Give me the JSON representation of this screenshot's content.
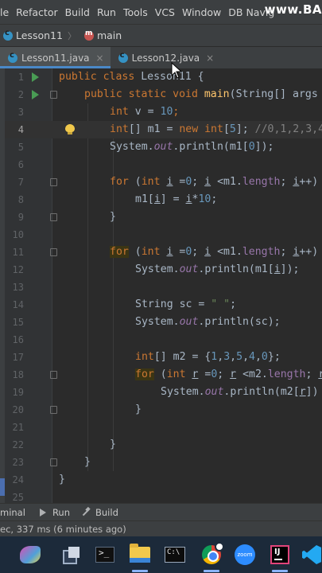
{
  "menu": {
    "items": [
      "le",
      "Refactor",
      "Build",
      "Run",
      "Tools",
      "VCS",
      "Window",
      "DB Navig"
    ],
    "watermark": "www.BA"
  },
  "breadcrumb": {
    "class_name": "Lesson11",
    "method_name": "main"
  },
  "tabs": [
    {
      "label": "Lesson11.java",
      "active": true,
      "close": "×"
    },
    {
      "label": "Lesson12.java",
      "active": false,
      "close": "×"
    }
  ],
  "editor": {
    "current_line": 4,
    "line_numbers": [
      "1",
      "2",
      "3",
      "4",
      "5",
      "6",
      "7",
      "8",
      "9",
      "10",
      "11",
      "12",
      "13",
      "14",
      "15",
      "16",
      "17",
      "18",
      "19",
      "20",
      "21",
      "22",
      "23",
      "24",
      "25"
    ],
    "lines": {
      "l1": {
        "kw1": "public class ",
        "name": "Lesson11 {"
      },
      "l2": {
        "kw1": "public static void ",
        "fn": "main",
        "rest": "(String[] args"
      },
      "l3": {
        "kw": "int ",
        "name": "v = ",
        "num": "10",
        "end": ";"
      },
      "l4": {
        "kw": "int",
        "a": "[] m1 = ",
        "kw2": "new int",
        "b": "[",
        "num": "5",
        "c": "]; ",
        "cmt": "//0,1,2,3,4"
      },
      "l5": {
        "a": "System.",
        "fld": "out",
        "b": ".println(m1[",
        "num": "0",
        "c": "]);"
      },
      "l7": {
        "kw": "for",
        "a": " (",
        "kw2": "int ",
        "v1": "i",
        "b": " =",
        "num": "0",
        "c": "; ",
        "v2": "i",
        "d": " <m1.",
        "fld": "length",
        "e": "; ",
        "v3": "i",
        "f": "++)"
      },
      "l8": {
        "a": "m1[",
        "v1": "i",
        "b": "] = ",
        "v2": "i",
        "c": "*",
        "num": "10",
        "d": ";"
      },
      "l9": {
        "a": "}"
      },
      "l11": {
        "kw": "for",
        "a": " (",
        "kw2": "int ",
        "v1": "i",
        "b": " =",
        "num": "0",
        "c": "; ",
        "v2": "i",
        "d": " <m1.",
        "fld": "length",
        "e": "; ",
        "v3": "i",
        "f": "++)"
      },
      "l12": {
        "a": "System.",
        "fld": "out",
        "b": ".println(m1[",
        "v1": "i",
        "c": "]);"
      },
      "l14": {
        "a": "String sc = ",
        "str": "\" \"",
        "b": ";"
      },
      "l15": {
        "a": "System.",
        "fld": "out",
        "b": ".println(sc);"
      },
      "l17": {
        "kw": "int",
        "a": "[] m2 = {",
        "n1": "1",
        "s1": ",",
        "n2": "3",
        "s2": ",",
        "n3": "5",
        "s3": ",",
        "n4": "4",
        "s4": ",",
        "n5": "0",
        "b": "};"
      },
      "l18": {
        "kw": "for",
        "a": " (",
        "kw2": "int ",
        "v1": "r",
        "b": " =",
        "num": "0",
        "c": "; ",
        "v2": "r",
        "d": " <m2.",
        "fld": "length",
        "e": "; ",
        "v3": "r"
      },
      "l19": {
        "a": "System.",
        "fld": "out",
        "b": ".println(m2[",
        "v1": "r",
        "c": "])"
      },
      "l20": {
        "a": "}"
      },
      "l22": {
        "a": "}"
      },
      "l23": {
        "a": "}"
      },
      "l24": {
        "a": "}"
      }
    }
  },
  "toolwindows": {
    "terminal": "minal",
    "run": "Run",
    "build": "Build"
  },
  "status": {
    "text": "ec, 337 ms (6 minutes ago)"
  },
  "taskbar": {
    "zoom_label": "zoom"
  }
}
